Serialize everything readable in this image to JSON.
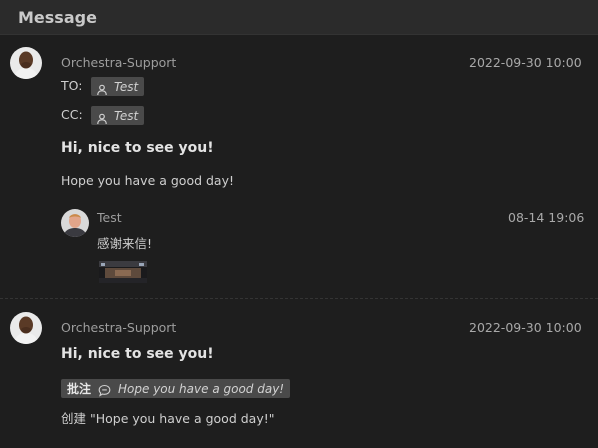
{
  "header": {
    "title": "Message"
  },
  "message1": {
    "sender": "Orchestra-Support",
    "timestamp": "2022-09-30 10:00",
    "to_label": "TO:",
    "to_recipient": "Test",
    "cc_label": "CC:",
    "cc_recipient": "Test",
    "subject": "Hi, nice to see you!",
    "body": "Hope you have a good day!",
    "reply": {
      "sender": "Test",
      "timestamp": "08-14 19:06",
      "body": "感谢来信!"
    }
  },
  "message2": {
    "sender": "Orchestra-Support",
    "timestamp": "2022-09-30 10:00",
    "subject": "Hi, nice to see you!",
    "annotation": {
      "prefix": "批注",
      "text": "Hope you have a good day!"
    },
    "body": "创建 \"Hope you have a good day!\""
  },
  "icons": {
    "recipient": "person-icon",
    "annotation": "comment-icon"
  }
}
